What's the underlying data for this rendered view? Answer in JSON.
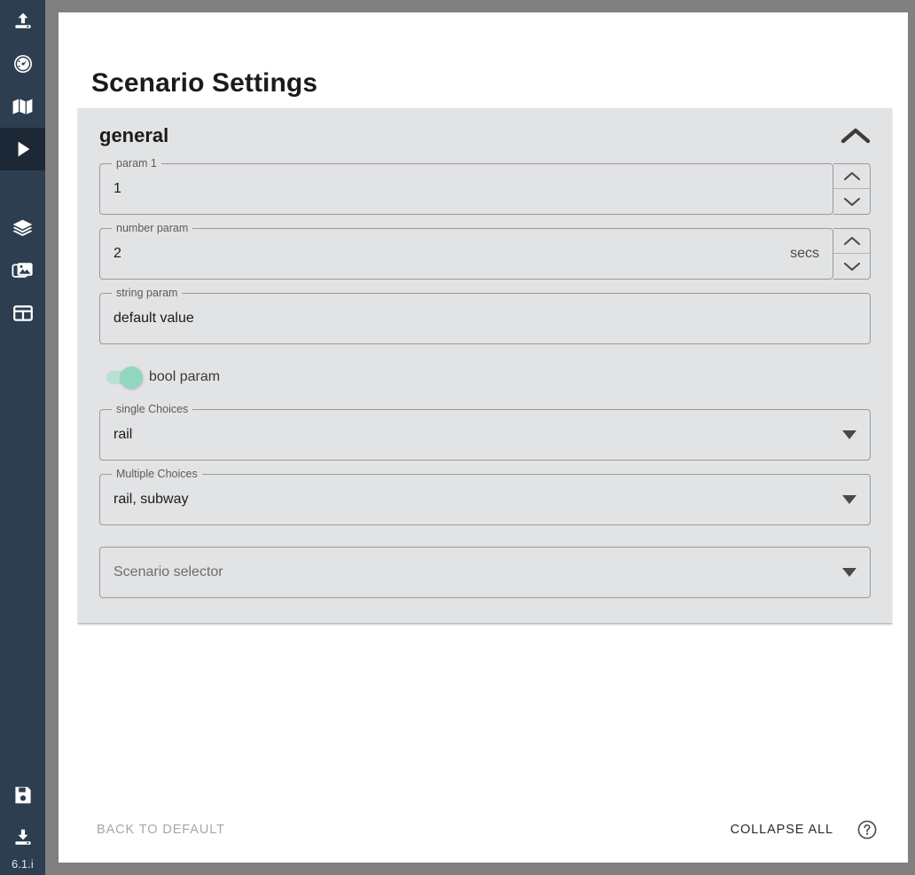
{
  "sidebar": {
    "items": [
      {
        "name": "upload-icon",
        "icon": "upload",
        "active": false
      },
      {
        "name": "dashboard-icon",
        "icon": "gauge",
        "active": false
      },
      {
        "name": "map-icon",
        "icon": "map",
        "active": false
      },
      {
        "name": "play-icon",
        "icon": "play",
        "active": true
      },
      {
        "name": "layers-icon",
        "icon": "layers",
        "active": false
      },
      {
        "name": "images-icon",
        "icon": "images",
        "active": false
      },
      {
        "name": "table-icon",
        "icon": "table",
        "active": false
      },
      {
        "name": "save-icon",
        "icon": "save",
        "active": false
      },
      {
        "name": "download-icon",
        "icon": "download",
        "active": false
      }
    ],
    "version": "6.1.i",
    "bg_color": "#2c3e50",
    "active_color": "#1d2836"
  },
  "page": {
    "title": "Scenario Settings"
  },
  "accordion": {
    "title": "general",
    "expanded": true,
    "collapse_icon": "chevron-up-icon"
  },
  "fields": {
    "param1": {
      "label": "param 1",
      "value": "1",
      "suffix": "",
      "type": "number"
    },
    "number_param": {
      "label": "number param",
      "value": "2",
      "suffix": "secs",
      "type": "number"
    },
    "string_param": {
      "label": "string param",
      "value": "default value",
      "type": "text"
    },
    "bool_param": {
      "label": "bool param",
      "checked": true,
      "track_color": "#b8e0d4",
      "knob_color": "#91d6c0"
    },
    "single_choices": {
      "label": "single Choices",
      "value": "rail",
      "type": "select"
    },
    "multiple_choices": {
      "label": "Multiple Choices",
      "value": "rail, subway",
      "type": "multiselect"
    },
    "scenario_selector": {
      "label": "",
      "placeholder": "Scenario selector",
      "value": "Scenario selector",
      "type": "select"
    }
  },
  "footer": {
    "back_to_default": "BACK TO DEFAULT",
    "collapse_all": "COLLAPSE ALL",
    "help_icon": "help-circle-icon"
  }
}
